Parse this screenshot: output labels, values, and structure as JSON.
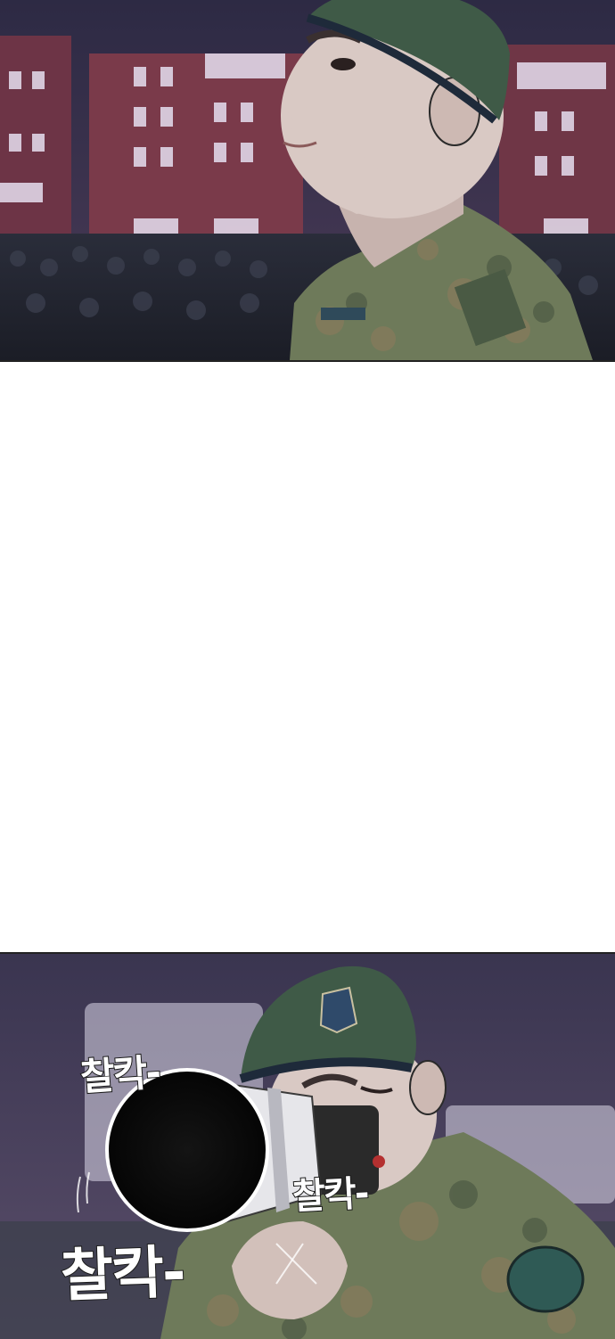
{
  "panels": [
    {
      "id": "top",
      "scene": "soldier-in-beret-looking-up"
    },
    {
      "id": "bottom",
      "scene": "soldier-taking-photo"
    }
  ],
  "sound_effects": [
    {
      "text": "찰칵-"
    },
    {
      "text": "찰칵-"
    },
    {
      "text": "찰칵-"
    }
  ],
  "colors": {
    "beret": "#3f5a47",
    "sky": "#3a3550",
    "building": "#7a3a4a",
    "skin": "#d9c9c4",
    "camo": "#6e7a5a"
  }
}
